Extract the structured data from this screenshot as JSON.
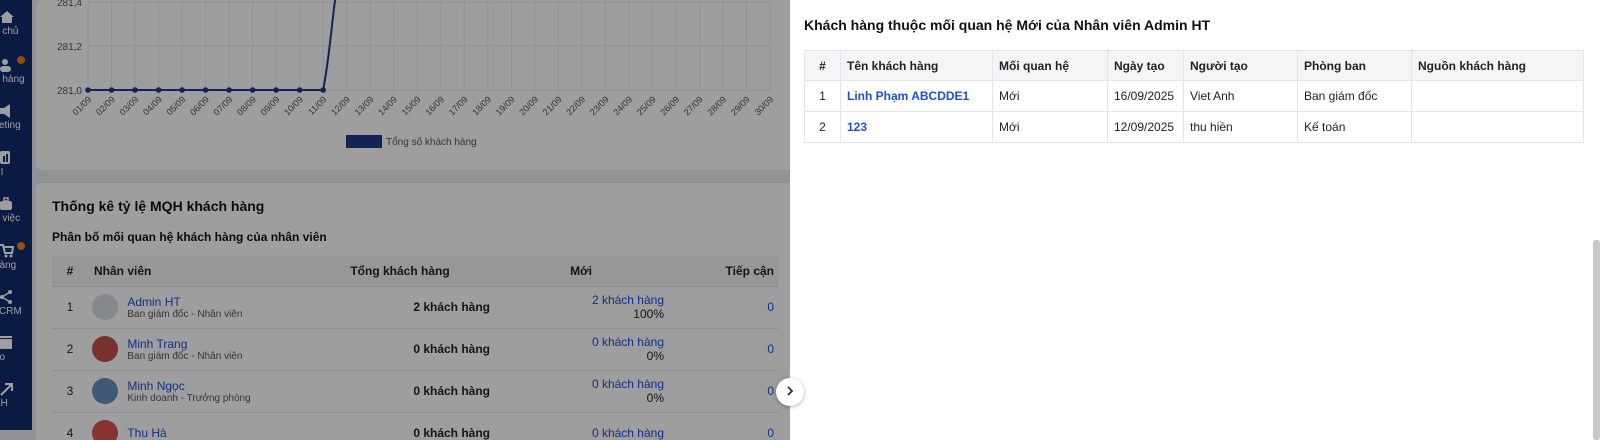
{
  "nav": {
    "items": [
      {
        "label": "g chủ",
        "icon": "home-icon"
      },
      {
        "label": "h hàng",
        "icon": "users-icon"
      },
      {
        "label": "keting",
        "icon": "megaphone-icon"
      },
      {
        "label": "PI",
        "icon": "chart-icon"
      },
      {
        "label": "g việc",
        "icon": "briefcase-icon"
      },
      {
        "label": "hàng",
        "icon": "cart-icon"
      },
      {
        "label": "i CRM",
        "icon": "share-icon"
      },
      {
        "label": "ho",
        "icon": "box-icon"
      },
      {
        "label": "KH",
        "icon": "expand-icon"
      }
    ],
    "accent_color": "#e67e22",
    "bg_color": "#0f2d6b"
  },
  "chart_data": {
    "type": "line",
    "categories": [
      "01/09",
      "02/09",
      "03/09",
      "04/09",
      "05/09",
      "06/09",
      "07/09",
      "08/09",
      "09/09",
      "10/09",
      "11/09",
      "12/09",
      "13/09",
      "14/09",
      "15/09",
      "16/09",
      "17/09",
      "18/09",
      "19/09",
      "20/09",
      "21/09",
      "22/09",
      "23/09",
      "24/09",
      "25/09",
      "26/09",
      "27/09",
      "28/09",
      "29/09",
      "30/09"
    ],
    "series": [
      {
        "name": "Tổng số khách hàng",
        "values": [
          281,
          281,
          281,
          281,
          281,
          281,
          281,
          281,
          281,
          281,
          281
        ]
      }
    ],
    "y_ticks": [
      "281,4",
      "281,2",
      "281,0"
    ],
    "ylim": [
      281.0,
      281.5
    ],
    "grid": true,
    "legend": "bottom",
    "color": "#1e3a8a"
  },
  "stats": {
    "title": "Thống kê tỷ lệ MQH khách hàng",
    "subtitle": "Phân bố mối quan hệ khách hàng của nhân viên",
    "columns": [
      "#",
      "Nhân viên",
      "Tổng khách hàng",
      "Mới",
      "Tiếp cận"
    ],
    "rows": [
      {
        "idx": "1",
        "name": "Admin HT",
        "dept": "Ban giám đốc - Nhân viên",
        "total": "2 khách hàng",
        "new": "2 khách hàng",
        "pct": "100%",
        "next": "0"
      },
      {
        "idx": "2",
        "name": "Minh Trang",
        "dept": "Ban giám đốc - Nhân viên",
        "total": "0 khách hàng",
        "new": "0 khách hàng",
        "pct": "0%",
        "next": "0"
      },
      {
        "idx": "3",
        "name": "Minh Ngọc",
        "dept": "Kinh doanh - Trưởng phòng",
        "total": "0 khách hàng",
        "new": "0 khách hàng",
        "pct": "0%",
        "next": "0"
      },
      {
        "idx": "4",
        "name": "Thu Hà",
        "dept": "",
        "total": "0 khách hàng",
        "new": "0 khách hàng",
        "pct": "",
        "next": "0"
      }
    ]
  },
  "panel": {
    "title": "Khách hàng thuộc mối quan hệ Mới của Nhân viên Admin HT",
    "columns": [
      "#",
      "Tên khách hàng",
      "Mối quan hệ",
      "Ngày tạo",
      "Người tạo",
      "Phòng ban",
      "Nguồn khách hàng"
    ],
    "rows": [
      {
        "idx": "1",
        "name": "Linh Phạm ABCDDE1",
        "relation": "Mới",
        "created": "16/09/2025",
        "creator": "Viet Anh",
        "dept": "Ban giám đốc",
        "source": ""
      },
      {
        "idx": "2",
        "name": "123",
        "relation": "Mới",
        "created": "12/09/2025",
        "creator": "thu hiền",
        "dept": "Kế toán",
        "source": ""
      }
    ]
  }
}
